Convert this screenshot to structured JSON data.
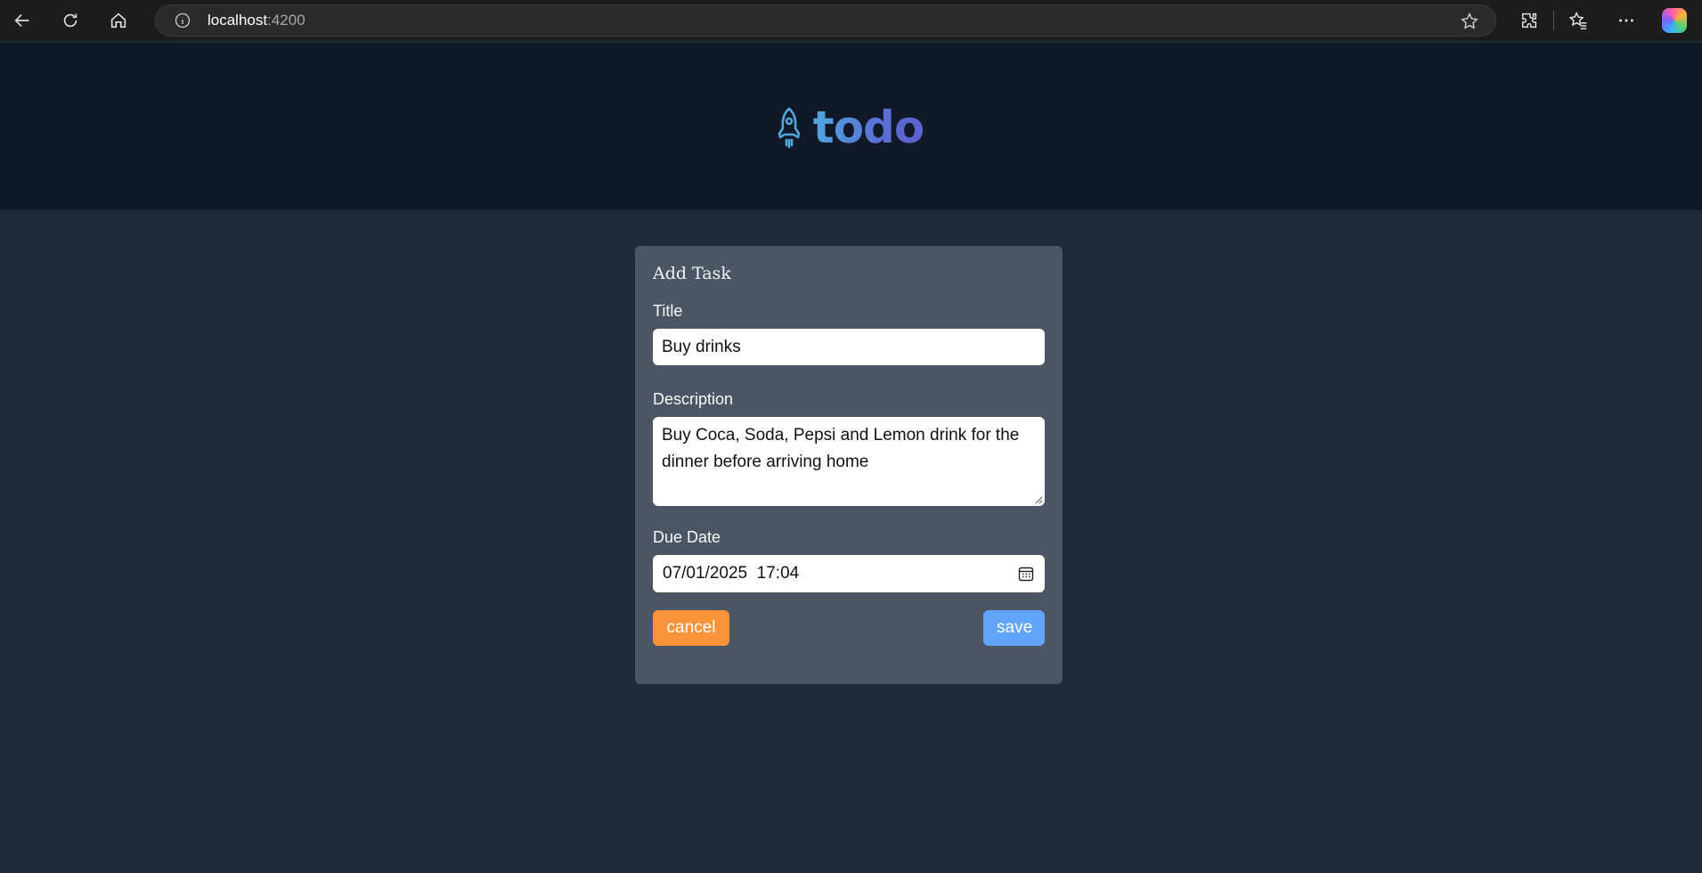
{
  "browser": {
    "url_host": "localhost",
    "url_port": ":4200"
  },
  "app": {
    "logo_text": "todo"
  },
  "form": {
    "heading": "Add Task",
    "title_label": "Title",
    "title_value": "Buy drinks",
    "description_label": "Description",
    "description_value": "Buy Coca, Soda, Pepsi and Lemon drink for the dinner before arriving home",
    "due_date_label": "Due Date",
    "due_date_value": "07/01/2025  17:04",
    "cancel_label": "cancel",
    "save_label": "save"
  },
  "colors": {
    "header_bg": "#111827",
    "page_bg": "#1f2937",
    "card_bg": "#4b5563",
    "cancel": "#fb923c",
    "save": "#60a5fa"
  },
  "icons": [
    "back-icon",
    "refresh-icon",
    "home-icon",
    "info-icon",
    "star-icon",
    "extensions-icon",
    "favorites-icon",
    "more-icon",
    "copilot-icon",
    "rocket-icon",
    "calendar-icon"
  ]
}
